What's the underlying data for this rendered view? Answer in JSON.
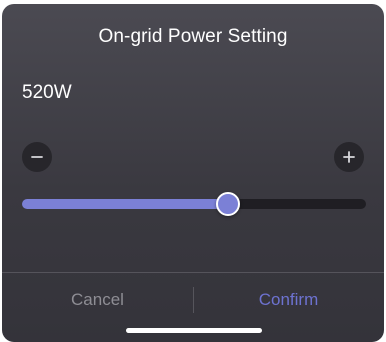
{
  "dialog": {
    "title": "On-grid Power Setting",
    "power_value": "520W"
  },
  "stepper": {
    "minus_icon": "minus-icon",
    "plus_icon": "plus-icon"
  },
  "slider": {
    "level_fraction": 0.6,
    "fill_color": "#7b80d6",
    "track_color": "#1f1e23"
  },
  "actions": {
    "cancel_label": "Cancel",
    "confirm_label": "Confirm",
    "confirm_color": "#6d72d0"
  }
}
